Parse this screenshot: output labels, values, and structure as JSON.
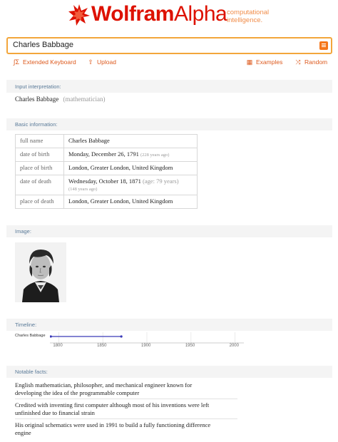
{
  "header": {
    "logo_wolfram": "Wolfram",
    "logo_alpha": "Alpha",
    "tagline_line1": "computational",
    "tagline_line2": "intelligence."
  },
  "search": {
    "value": "Charles Babbage"
  },
  "toolbar": {
    "extended_keyboard": "Extended Keyboard",
    "upload": "Upload",
    "examples": "Examples",
    "random": "Random"
  },
  "pods": {
    "input": {
      "label": "Input interpretation:",
      "name": "Charles Babbage",
      "qualifier": "(mathematician)"
    },
    "basic": {
      "label": "Basic information:",
      "rows": [
        {
          "key": "full name",
          "value": "Charles Babbage",
          "note": ""
        },
        {
          "key": "date of birth",
          "value": "Monday, December 26, 1791",
          "note": "(228 years ago)"
        },
        {
          "key": "place of birth",
          "value": "London, Greater London, United Kingdom",
          "note": ""
        },
        {
          "key": "date of death",
          "value": "Wednesday, October 18, 1871",
          "note": "(age: 79 years)",
          "note2": "(148 years ago)"
        },
        {
          "key": "place of death",
          "value": "London, Greater London, United Kingdom",
          "note": ""
        }
      ]
    },
    "image": {
      "label": "Image:"
    },
    "timeline": {
      "label": "Timeline:",
      "series_label": "Charles Babbage",
      "start_year": 1791,
      "end_year": 1871,
      "axis_min": 1790,
      "axis_max": 2010,
      "ticks": [
        "1800",
        "1850",
        "1900",
        "1950",
        "2000"
      ],
      "bar_color": "#3a3ab8"
    },
    "facts": {
      "label": "Notable facts:",
      "items": [
        {
          "line1": "English mathematician, philosopher, and mechanical engineer known for",
          "line2": "developing the idea of the programmable computer"
        },
        {
          "line1": "Credited with inventing first computer although most of his inventions were left",
          "line2": "unfinished due to financial strain"
        },
        {
          "line1": "His original schematics were used in 1991 to build a fully functioning difference",
          "line2": "engine"
        }
      ]
    }
  },
  "colors": {
    "brand_red": "#dd1100",
    "accent_orange": "#f3a63b",
    "link_orange": "#dd5a1e",
    "pod_label": "#5a7a98"
  }
}
